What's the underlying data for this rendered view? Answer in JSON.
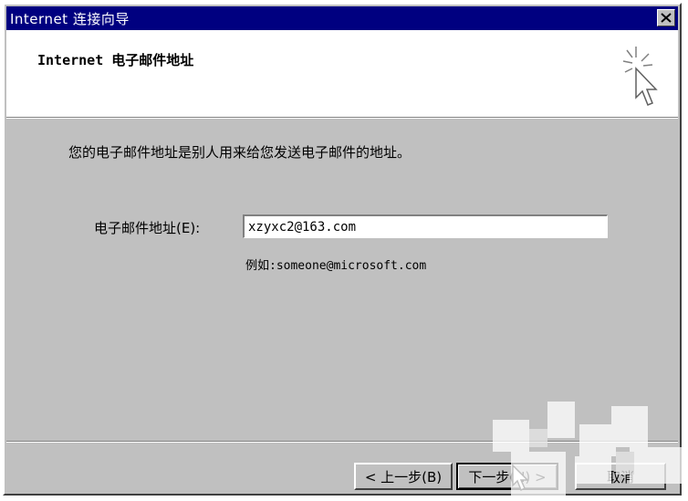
{
  "window": {
    "title": "Internet 连接向导",
    "close_glyph": "×"
  },
  "header": {
    "title": "Internet 电子邮件地址",
    "icon": "wizard-sparkle-cursor-icon"
  },
  "body": {
    "description": "您的电子邮件地址是别人用来给您发送电子邮件的地址。",
    "email_label": "电子邮件地址(E):",
    "email_value": "xzyxc2@163.com",
    "example": "例如:someone@microsoft.com"
  },
  "buttons": {
    "back": "< 上一步(B)",
    "next": "下一步(N) >",
    "cancel": "取消"
  },
  "colors": {
    "titlebar": "#000080",
    "face": "#c0c0c0"
  }
}
